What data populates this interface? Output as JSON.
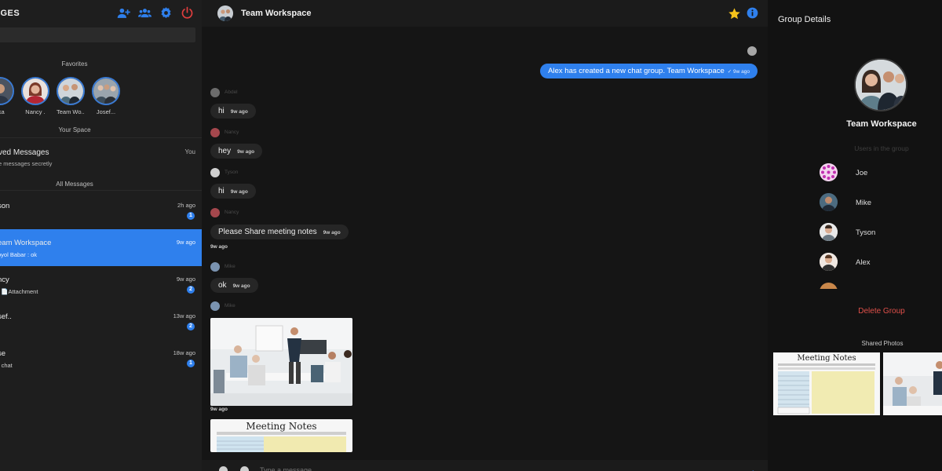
{
  "sidebar": {
    "title": "AGES",
    "search_placeholder": "",
    "favorites_label": "Favorites",
    "favorites": [
      {
        "name": "lika"
      },
      {
        "name": "Nancy ."
      },
      {
        "name": "Team Wo..."
      },
      {
        "name": "Josef..."
      }
    ],
    "your_space_label": "Your Space",
    "saved": {
      "title": "ved Messages",
      "subtitle": "e messages secretly",
      "tag": "You"
    },
    "all_messages_label": "All Messages",
    "conversations": [
      {
        "name": "son",
        "preview": "",
        "time": "2h ago",
        "badge": "1",
        "active": false
      },
      {
        "name": "eam Workspace",
        "preview": "oyol Babar : ok",
        "time": "9w ago",
        "badge": "",
        "active": true
      },
      {
        "name": "ncy",
        "preview": ": 📄Attachment",
        "time": "9w ago",
        "badge": "2",
        "active": false
      },
      {
        "name": "sef..",
        "preview": "",
        "time": "13w ago",
        "badge": "2",
        "active": false
      },
      {
        "name": "se",
        "preview": "r chat",
        "time": "18w ago",
        "badge": "1",
        "active": false
      }
    ]
  },
  "chat": {
    "title": "Team Workspace",
    "system_message": {
      "text": "Alex has created a new chat group. Team Workspace",
      "time": "✓ 9w ago"
    },
    "messages": [
      {
        "sender": "Abdel",
        "text": "hi",
        "time": "9w ago",
        "color": "#6c6c6c"
      },
      {
        "sender": "Nancy",
        "text": "hey",
        "time": "9w ago",
        "color": "#a4474d"
      },
      {
        "sender": "Tyson",
        "text": "hi",
        "time": "9w ago",
        "color": "#cfcfcf"
      },
      {
        "sender": "Nancy",
        "text": "Please Share meeting notes",
        "time": "9w ago",
        "color": "#a4474d"
      },
      {
        "sender": "Mike",
        "text": "ok",
        "time": "9w ago",
        "color": "#7a93b0"
      }
    ],
    "after_notes_time": "9w ago",
    "photo_sender": "Mike",
    "photo_time": "9w ago",
    "notes_title": "Meeting Notes",
    "composer_placeholder": "Type a message"
  },
  "details": {
    "title": "Group Details",
    "group_name": "Team Workspace",
    "users_label": "Users in the group",
    "members": [
      {
        "name": "Joe"
      },
      {
        "name": "Mike"
      },
      {
        "name": "Tyson"
      },
      {
        "name": "Alex"
      }
    ],
    "delete_label": "Delete Group",
    "shared_photos_label": "Shared Photos",
    "shared_notes_title": "Meeting Notes"
  },
  "colors": {
    "accent": "#2f80ed",
    "star": "#f5c21b",
    "power": "#e03e3e",
    "delete": "#e0504a"
  }
}
